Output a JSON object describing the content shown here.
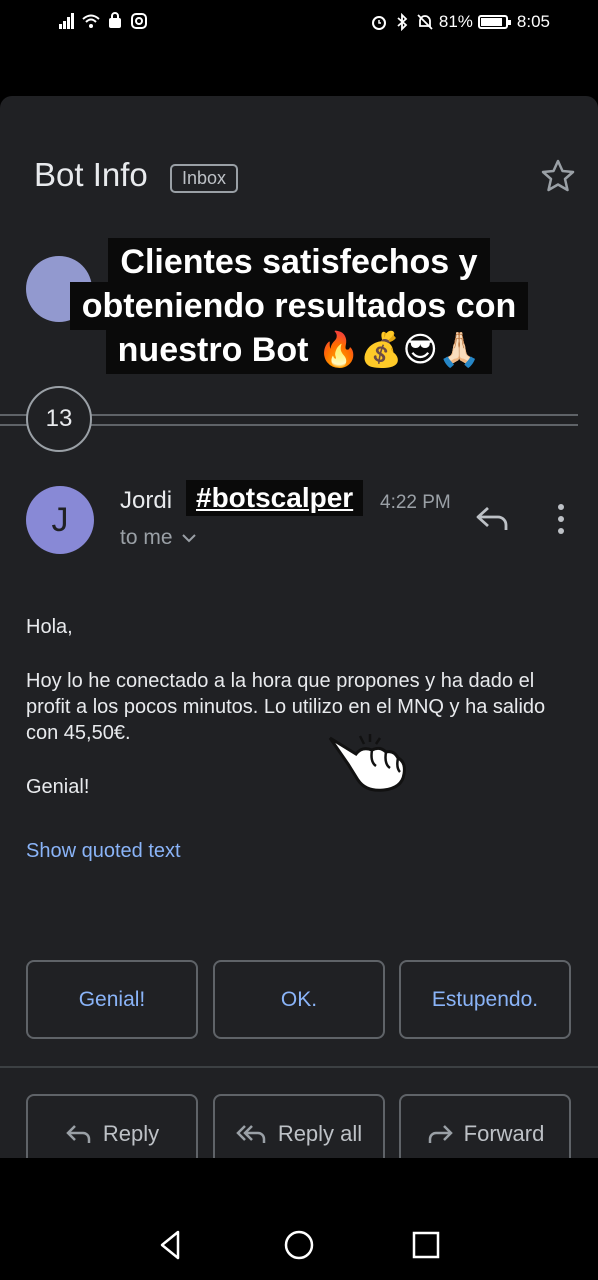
{
  "status_bar": {
    "battery": "81%",
    "battery_level": 0.81,
    "time": "8:05",
    "left_icons": [
      "signal-icon",
      "wifi-icon",
      "bag-icon",
      "instagram-icon"
    ],
    "right_icons": [
      "alarm-icon",
      "bluetooth-icon",
      "mute-icon"
    ]
  },
  "email": {
    "subject": "Bot Info",
    "label": "Inbox",
    "collapsed_count": "13",
    "sender": "Jordi",
    "time": "4:22 PM",
    "to": "to me",
    "body": [
      "Hola,",
      "Hoy lo he conectado a la hora que propones y ha dado el profit a los pocos minutos. Lo utilizo en el MNQ y ha salido con 45,50€.",
      "Genial!"
    ],
    "show_quoted": "Show quoted text"
  },
  "overlay": {
    "lines": [
      "Clientes satisfechos y",
      "obteniendo resultados con",
      "nuestro Bot 🔥💰😎🙏🏻"
    ],
    "hashtag": "#botscalper"
  },
  "smart_replies": [
    "Genial!",
    "OK.",
    "Estupendo."
  ],
  "actions": [
    {
      "label": "Reply",
      "icon": "reply-icon"
    },
    {
      "label": "Reply all",
      "icon": "reply-all-icon"
    },
    {
      "label": "Forward",
      "icon": "forward-icon"
    }
  ],
  "colors": {
    "background": "#202124",
    "link": "#8ab4f8",
    "avatar": "#8889d6"
  }
}
